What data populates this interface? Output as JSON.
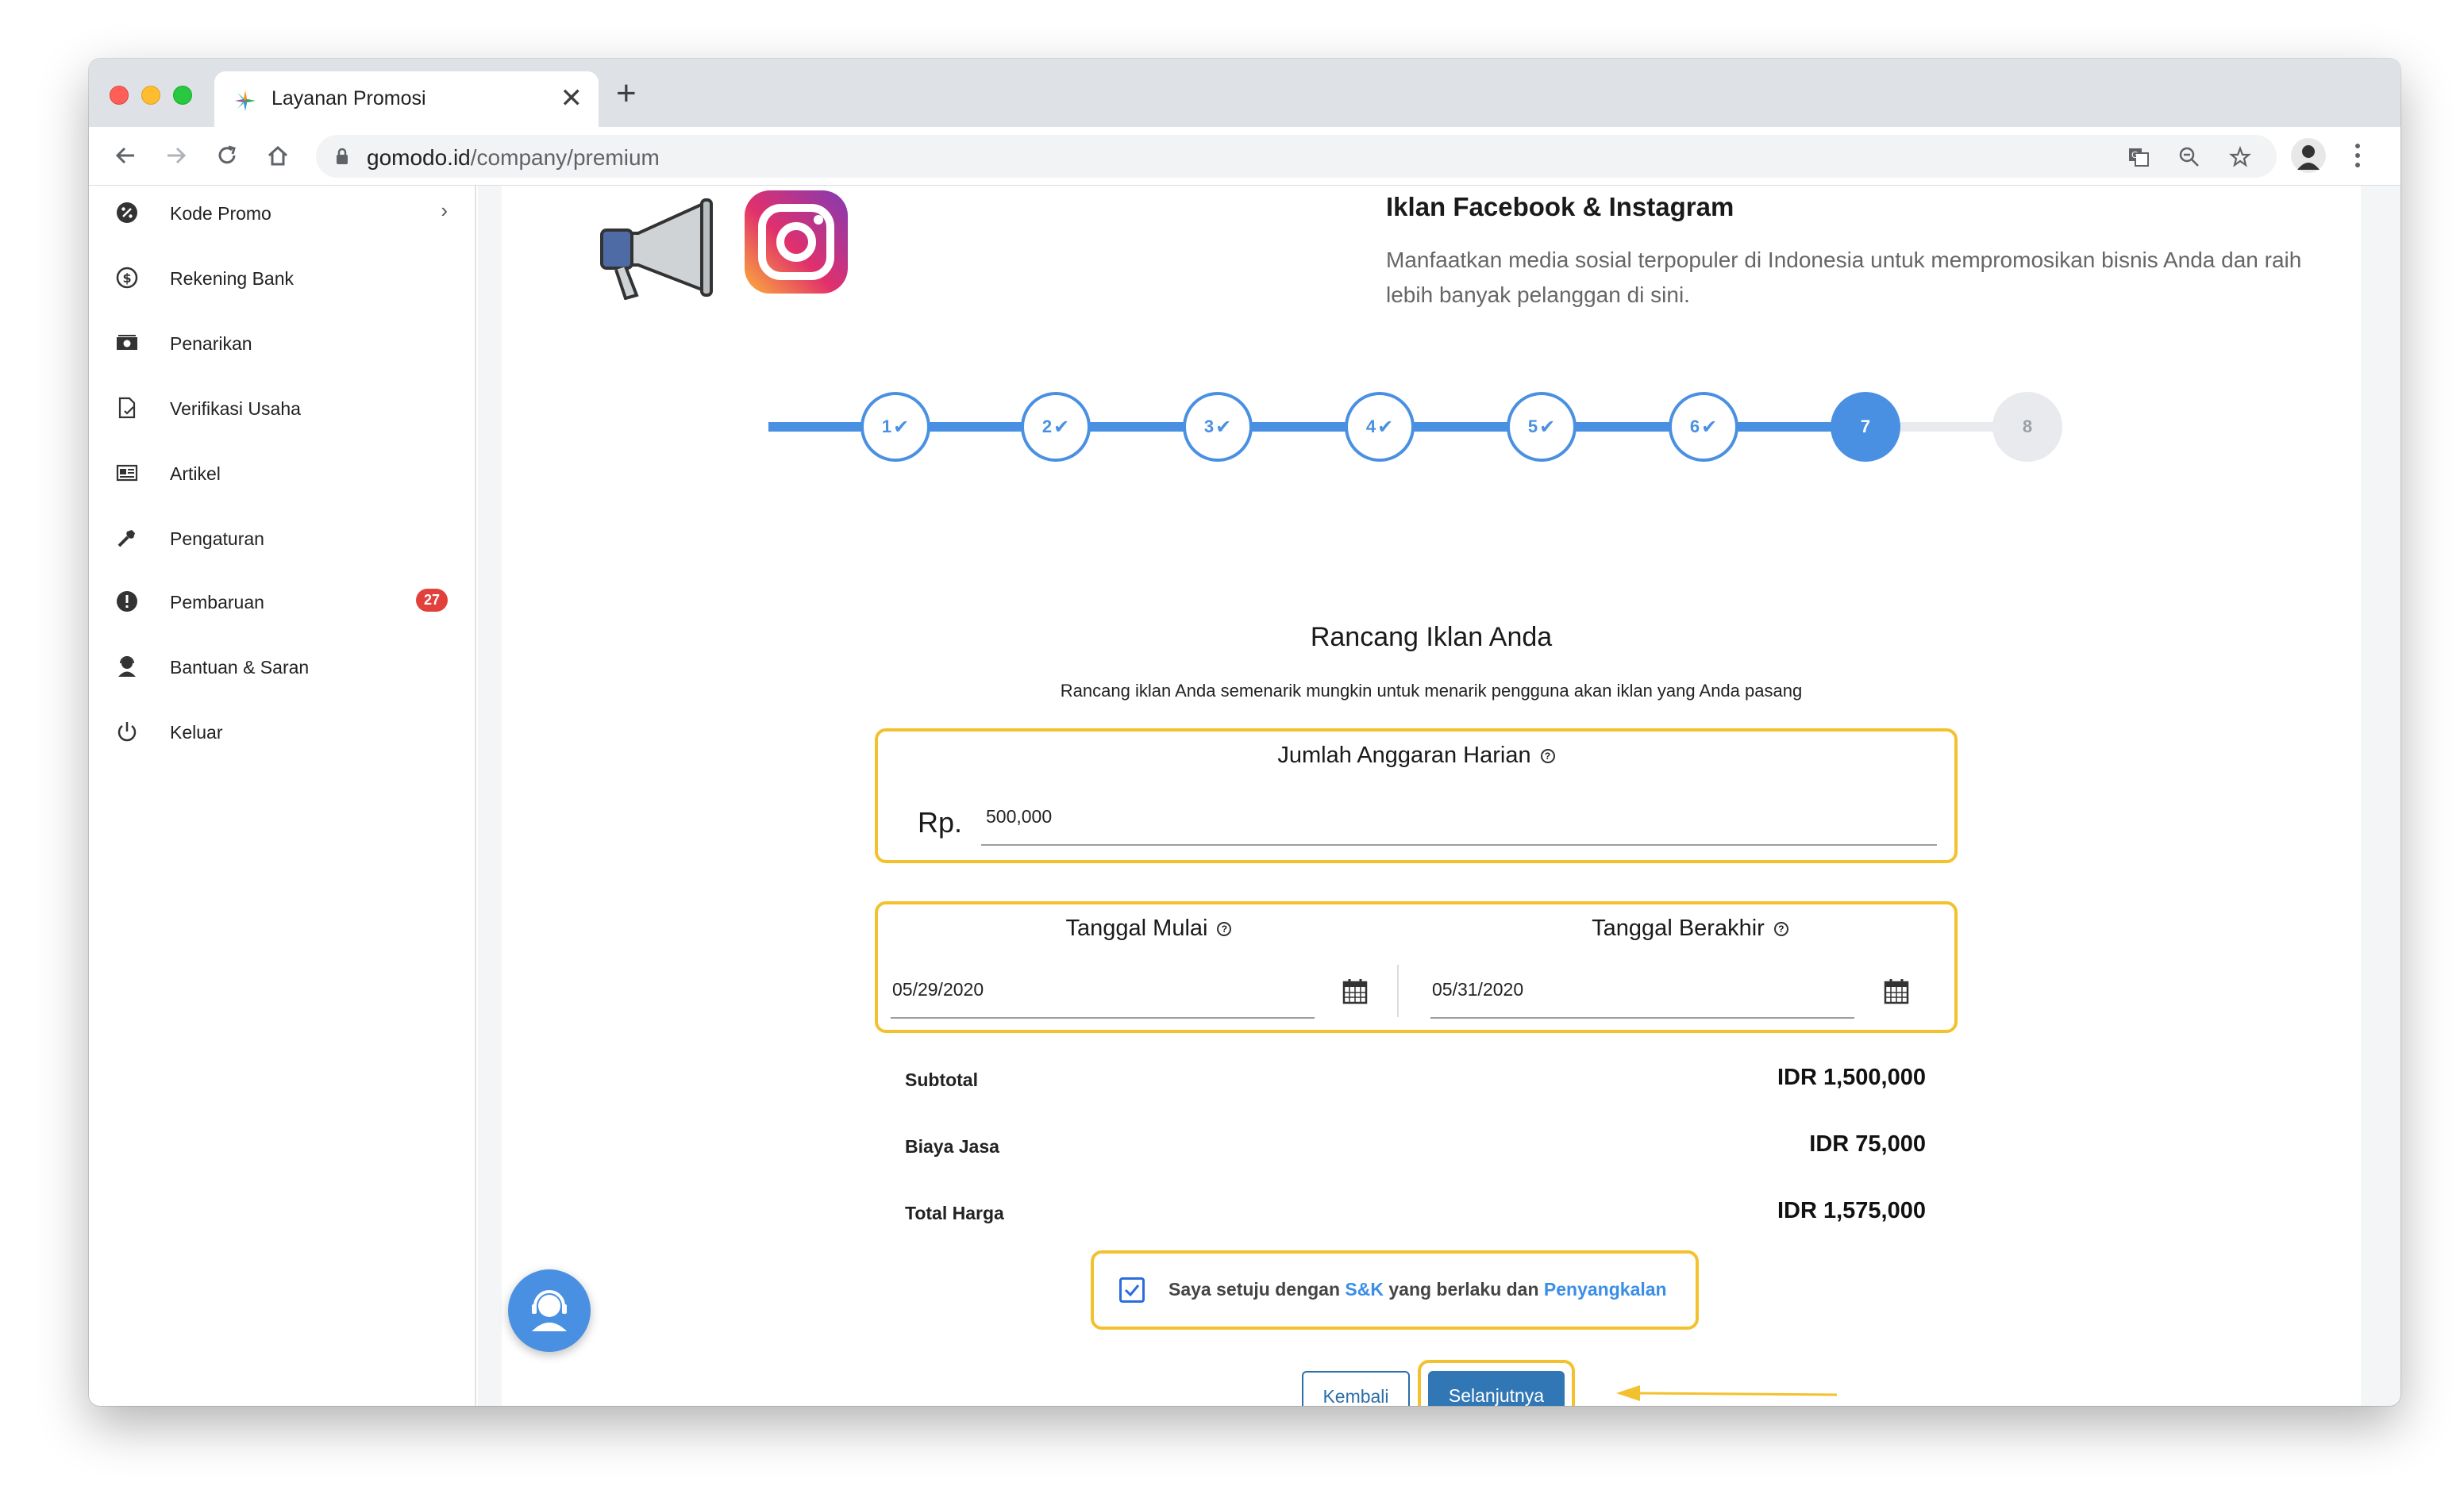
{
  "browser": {
    "tab_title": "Layanan Promosi",
    "url_host": "gomodo.id",
    "url_path": "/company/premium",
    "new_tab_label": "+",
    "close_tab_label": "✕"
  },
  "sidebar": {
    "items": [
      {
        "label": "Kode Promo",
        "icon": "percent-icon",
        "chevron": "›"
      },
      {
        "label": "Rekening Bank",
        "icon": "dollar-circle-icon"
      },
      {
        "label": "Penarikan",
        "icon": "money-icon"
      },
      {
        "label": "Verifikasi Usaha",
        "icon": "document-check-icon"
      },
      {
        "label": "Artikel",
        "icon": "newspaper-icon"
      },
      {
        "label": "Pengaturan",
        "icon": "wrench-icon"
      },
      {
        "label": "Pembaruan",
        "icon": "alert-icon",
        "badge": "27"
      },
      {
        "label": "Bantuan & Saran",
        "icon": "support-agent-icon"
      },
      {
        "label": "Keluar",
        "icon": "power-icon"
      }
    ]
  },
  "header": {
    "title": "Iklan Facebook & Instagram",
    "description": "Manfaatkan media sosial terpopuler di Indonesia untuk mempromosikan bisnis Anda dan raih lebih banyak pelanggan di sini."
  },
  "stepper": {
    "steps": [
      "1",
      "2",
      "3",
      "4",
      "5",
      "6",
      "7",
      "8"
    ],
    "completed": 6,
    "current": 7,
    "check": "✔"
  },
  "form": {
    "title": "Rancang Iklan Anda",
    "subtitle": "Rancang iklan Anda semenarik mungkin untuk menarik pengguna akan iklan yang Anda pasang",
    "budget_label": "Jumlah Anggaran Harian",
    "currency_prefix": "Rp.",
    "budget_value": "500,000",
    "start_label": "Tanggal Mulai",
    "start_value": "05/29/2020",
    "end_label": "Tanggal Berakhir",
    "end_value": "05/31/2020",
    "help": "?"
  },
  "summary": {
    "subtotal_label": "Subtotal",
    "subtotal_value": "IDR 1,500,000",
    "fee_label": "Biaya Jasa",
    "fee_value": "IDR 75,000",
    "total_label": "Total Harga",
    "total_value": "IDR 1,575,000"
  },
  "agreement": {
    "prefix": "Saya setuju dengan ",
    "link1": "S&K",
    "middle": " yang berlaku dan ",
    "link2": "Penyangkalan",
    "checked": true
  },
  "buttons": {
    "back": "Kembali",
    "next": "Selanjutnya"
  },
  "colors": {
    "accent": "#4a90e2",
    "highlight": "#f3c12e",
    "badge": "#e2403b",
    "primary_button": "#3177b5"
  }
}
